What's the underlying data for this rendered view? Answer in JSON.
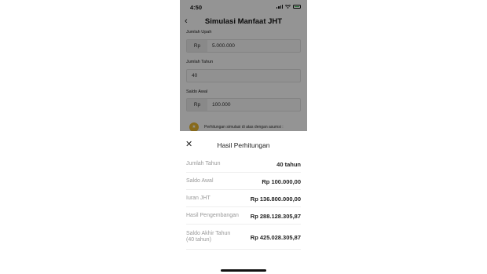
{
  "status": {
    "time": "4:50"
  },
  "header": {
    "title": "Simulasi Manfaat JHT"
  },
  "form": {
    "wage_label": "Jumlah Upah",
    "wage_prefix": "Rp",
    "wage_value": "5.000.000",
    "years_label": "Jumlah Tahun",
    "years_value": "40",
    "balance_label": "Saldo Awal",
    "balance_prefix": "Rp",
    "balance_value": "100.000",
    "note": "Perhitungan simulasi di atas dengan asumsi :"
  },
  "sheet": {
    "title": "Hasil Perhitungan",
    "rows": [
      {
        "label": "Jumlah Tahun",
        "value": "40 tahun"
      },
      {
        "label": "Saldo Awal",
        "value": "Rp 100.000,00"
      },
      {
        "label": "Iuran JHT",
        "value": "Rp 136.800.000,00"
      },
      {
        "label": "Hasil Pengembangan",
        "value": "Rp 288.128.305,87"
      },
      {
        "label_line1": "Saldo Akhir Tahun",
        "label_line2": "(40 tahun)",
        "value": "Rp 425.028.305,87"
      }
    ]
  }
}
